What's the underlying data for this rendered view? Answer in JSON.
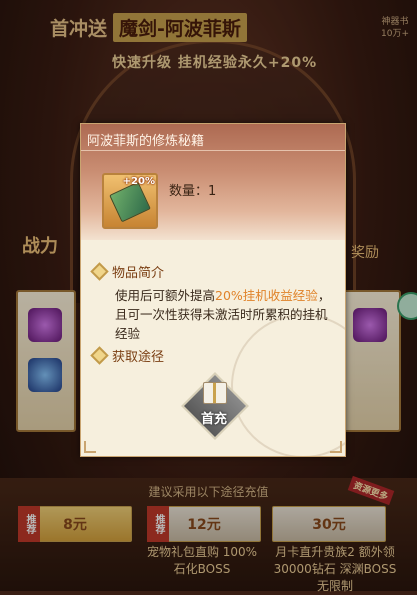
{
  "background": {
    "banner_prefix": "首冲送",
    "banner_highlight": "魔剑-阿波菲斯",
    "banner_sub": "快速升级 挂机经验永久+20%",
    "corner_text": "神器书 10万+",
    "mid_left": "战力",
    "mid_right": "奖励",
    "bottom_hint": "建议采用以下途径充值",
    "tiers": [
      {
        "price": "8元",
        "tag": "推荐"
      },
      {
        "price": "12元",
        "tag": "推荐",
        "desc": "宠物礼包直购 100%石化BOSS"
      },
      {
        "price": "30元",
        "ribbon": "资源更多",
        "desc": "月卡直升贵族2 额外领30000钻石 深渊BOSS无限制"
      }
    ]
  },
  "dialog": {
    "title": "阿波菲斯的修炼秘籍",
    "item_badge": "+20%",
    "quantity_label": "数量：",
    "quantity_value": "1",
    "intro_heading": "物品简介",
    "desc_part1": "使用后可额外提高",
    "desc_highlight": "20%挂机收益经验",
    "desc_part2": "，且可一次性获得未激活时所累积的挂机经验",
    "source_heading": "获取途径",
    "source_button_label": "首充"
  }
}
